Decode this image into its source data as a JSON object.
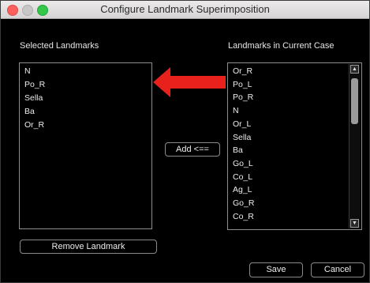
{
  "window": {
    "title": "Configure Landmark Superimposition"
  },
  "selected_panel": {
    "label": "Selected Landmarks",
    "items": [
      "N",
      "Po_R",
      "Sella",
      "Ba",
      "Or_R"
    ]
  },
  "current_panel": {
    "label": "Landmarks in Current Case",
    "items": [
      "Or_R",
      "Po_L",
      "Po_R",
      "N",
      "Or_L",
      "Sella",
      "Ba",
      "Go_L",
      "Co_L",
      "Ag_L",
      "Go_R",
      "Co_R"
    ]
  },
  "buttons": {
    "add": "Add <==",
    "remove": "Remove Landmark",
    "save": "Save",
    "cancel": "Cancel"
  },
  "annotation": {
    "arrow_color": "#e8211c"
  }
}
